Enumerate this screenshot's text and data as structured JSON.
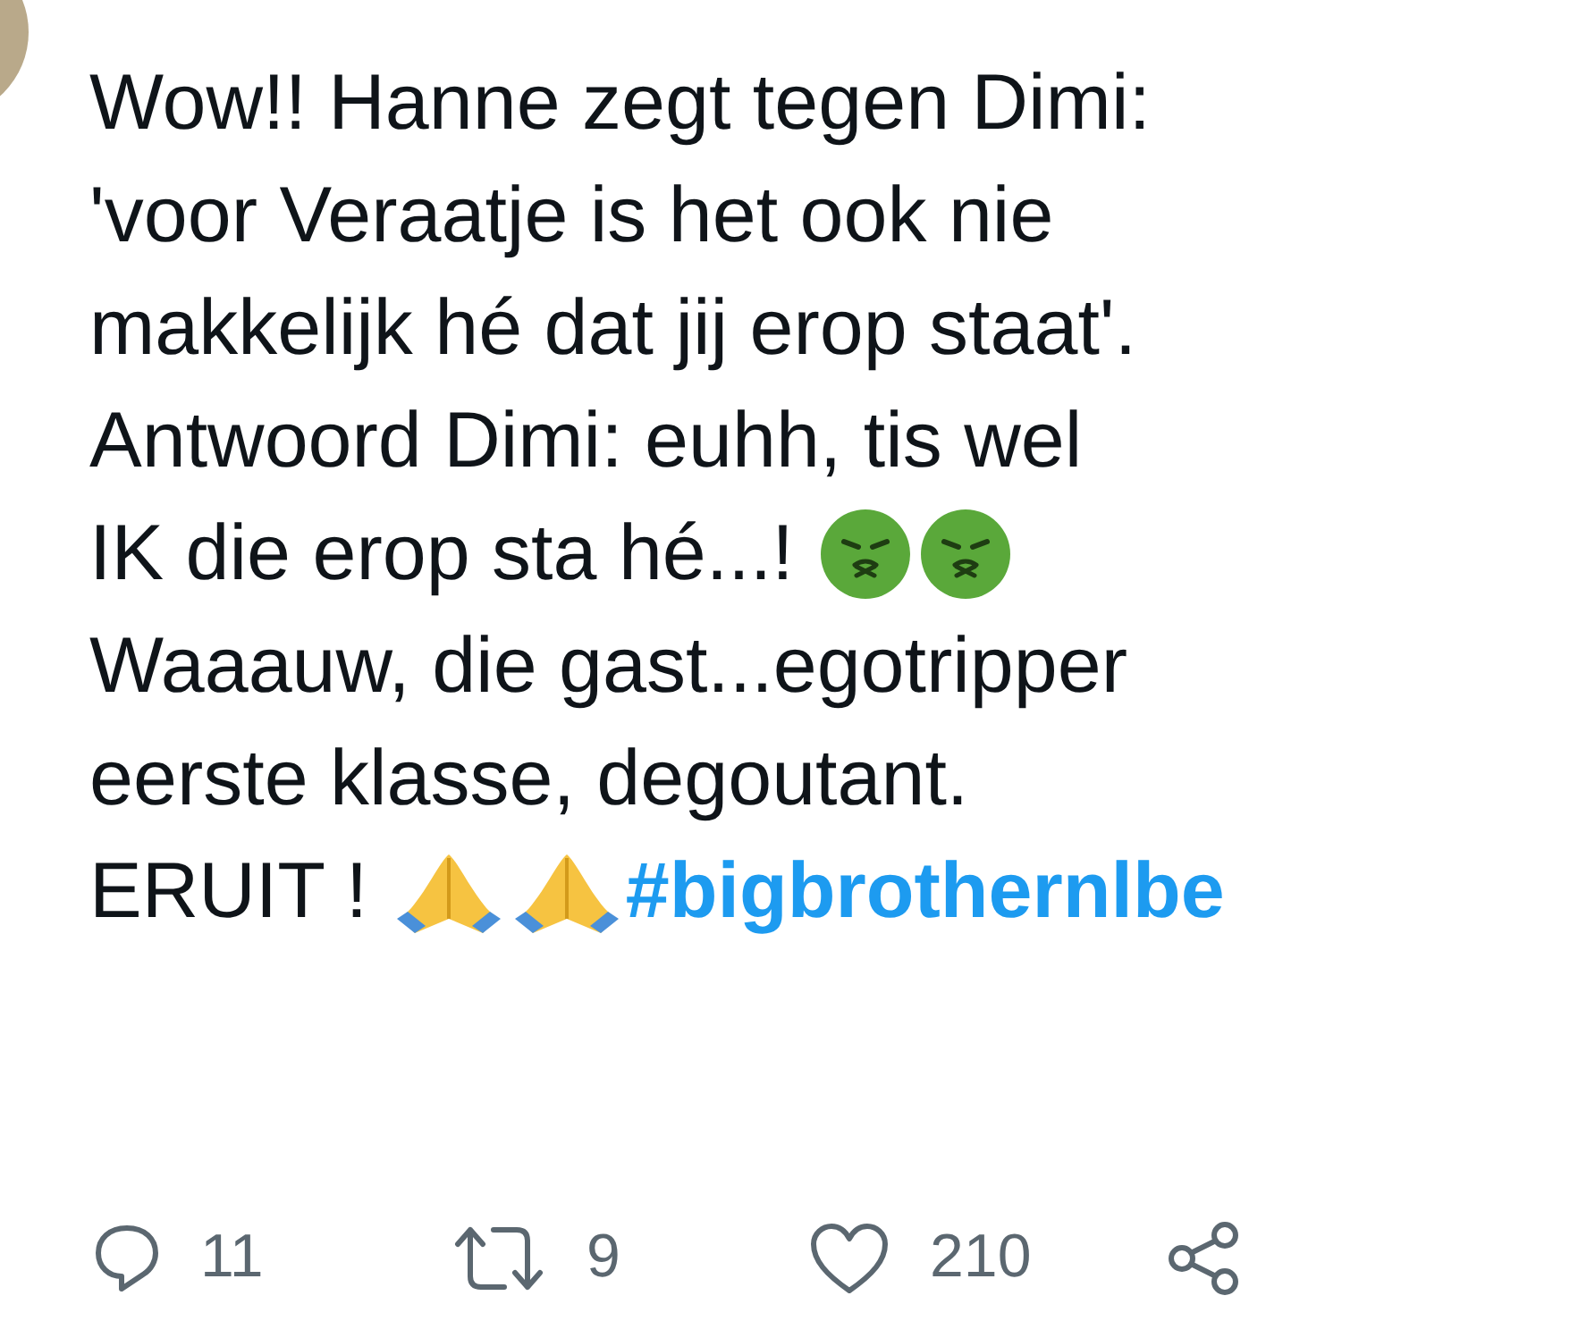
{
  "tweet": {
    "lines": [
      [
        {
          "kind": "text",
          "text": "Wow!! Hanne zegt tegen Dimi:"
        }
      ],
      [
        {
          "kind": "text",
          "text": "'voor Veraatje is het ook nie"
        }
      ],
      [
        {
          "kind": "text",
          "text": "makkelijk hé dat jij erop staat'."
        }
      ],
      [
        {
          "kind": "text",
          "text": "Antwoord Dimi: euhh, tis wel"
        }
      ],
      [
        {
          "kind": "text",
          "text": "IK die erop sta hé...! "
        },
        {
          "kind": "sick"
        },
        {
          "kind": "sick"
        }
      ],
      [
        {
          "kind": "text",
          "text": "Waaauw, die gast...egotripper"
        }
      ],
      [
        {
          "kind": "text",
          "text": "eerste klasse, degoutant."
        }
      ],
      [
        {
          "kind": "text",
          "text": "ERUIT ! "
        },
        {
          "kind": "pray"
        },
        {
          "kind": "pray"
        },
        {
          "kind": "hashtag",
          "text": "#bigbrothernlbe"
        }
      ]
    ]
  },
  "actions": [
    {
      "kind": "reply",
      "count": "11"
    },
    {
      "kind": "retweet",
      "count": "9"
    },
    {
      "kind": "like",
      "count": "210"
    },
    {
      "kind": "share"
    }
  ]
}
